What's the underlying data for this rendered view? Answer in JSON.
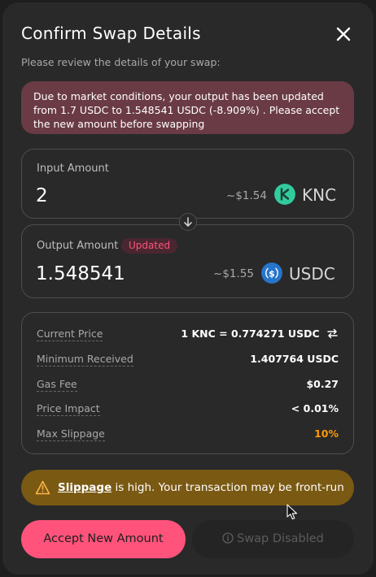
{
  "modal": {
    "title": "Confirm Swap Details",
    "subtitle": "Please review the details of your swap:",
    "close_icon": "close-icon"
  },
  "alert": {
    "message": "Due to market conditions, your output has been updated from 1.7 USDC to 1.548541 USDC (-8.909%) . Please accept the new amount before swapping"
  },
  "input": {
    "label": "Input Amount",
    "amount": "2",
    "usd": "~$1.54",
    "token_symbol": "KNC",
    "token_icon": "knc-token-icon",
    "token_color": "#31cb9e"
  },
  "direction_icon": "arrow-down-icon",
  "output": {
    "label": "Output Amount",
    "badge": "Updated",
    "amount": "1.548541",
    "usd": "~$1.55",
    "token_symbol": "USDC",
    "token_icon": "usdc-token-icon",
    "token_color": "#2775ca"
  },
  "details": [
    {
      "label": "Current Price",
      "value": "1 KNC = 0.774271 USDC"
    },
    {
      "label": "Minimum Received",
      "value": "1.407764 USDC"
    },
    {
      "label": "Gas Fee",
      "value": "$0.27"
    },
    {
      "label": "Price Impact",
      "value": "< 0.01%"
    },
    {
      "label": "Max Slippage",
      "value": "10%"
    }
  ],
  "warning": {
    "link": "Slippage",
    "text": " is high. Your transaction may be front-run",
    "icon": "warning-icon"
  },
  "buttons": {
    "accept": "Accept New Amount",
    "disabled": "Swap Disabled"
  },
  "colors": {
    "accent": "#ff537b",
    "background": "#292929",
    "alert_bg": "#6a3b45",
    "warning_bg": "#7a5913",
    "slippage_value": "#ff9901"
  }
}
